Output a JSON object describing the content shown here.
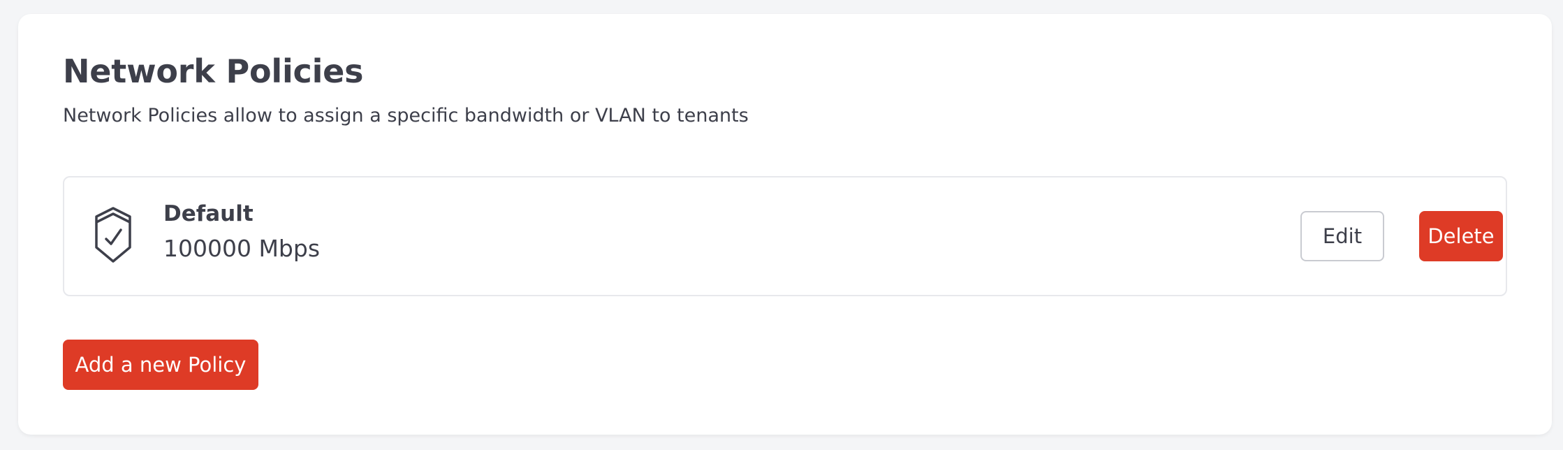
{
  "header": {
    "title": "Network Policies",
    "subtitle": "Network Policies allow to assign a specific bandwidth or VLAN to tenants"
  },
  "policies": [
    {
      "name": "Default",
      "bandwidth": "100000 Mbps",
      "icon": "shield-check-icon",
      "edit_label": "Edit",
      "delete_label": "Delete"
    }
  ],
  "actions": {
    "add_label": "Add a new Policy"
  },
  "colors": {
    "accent": "#de3b26",
    "text": "#3d3f4a",
    "page_background": "#f4f5f7",
    "card_background": "#ffffff",
    "border": "#e7e8ec"
  }
}
